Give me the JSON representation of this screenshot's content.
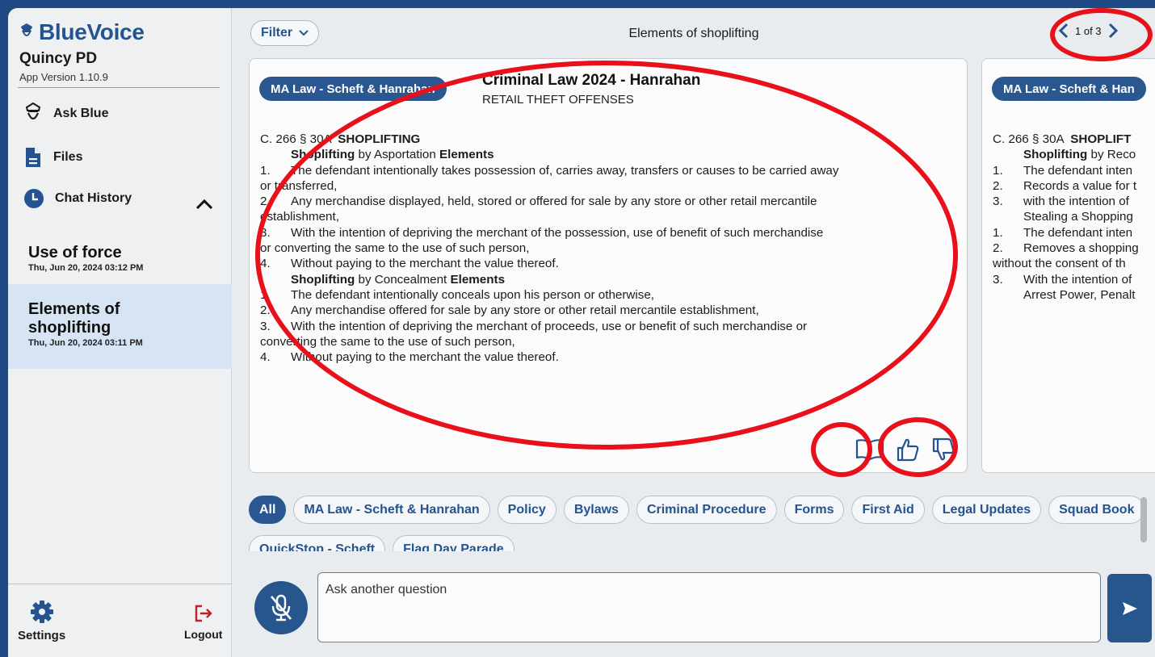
{
  "brand": {
    "name": "BlueVoice",
    "org": "Quincy PD",
    "version": "App Version 1.10.9"
  },
  "sidebar": {
    "nav": [
      {
        "label": "Ask Blue",
        "icon": "police-icon"
      },
      {
        "label": "Files",
        "icon": "file-icon"
      },
      {
        "label": "Chat History",
        "icon": "clock-icon"
      }
    ],
    "history": [
      {
        "title": "Use of force",
        "date": "Thu, Jun 20, 2024 03:12 PM",
        "active": false
      },
      {
        "title": "Elements of shoplifting",
        "date": "Thu, Jun 20, 2024 03:11 PM",
        "active": true
      }
    ],
    "settings_label": "Settings",
    "logout_label": "Logout"
  },
  "topbar": {
    "filter_label": "Filter",
    "topic": "Elements of shoplifting",
    "pager": "1 of 3"
  },
  "cards": [
    {
      "source": "MA Law - Scheft & Hanrahan",
      "title": "Criminal Law 2024 - Hanrahan",
      "subtitle": "RETAIL THEFT OFFENSES",
      "lines": [
        {
          "pre": "C. 266 § 30A  ",
          "bold": "SHOPLIFTING",
          "indent": false
        },
        {
          "bold": "Shoplifting",
          "mid": " by Asportation ",
          "bold2": "Elements",
          "indent": true
        },
        {
          "n": "1.",
          "text": "The defendant intentionally takes possession of, carries away, transfers or causes to be carried away"
        },
        {
          "plain": "or transferred,"
        },
        {
          "n": "2.",
          "text": "Any merchandise displayed, held, stored or offered for sale by any store or other retail mercantile"
        },
        {
          "plain": "establishment,"
        },
        {
          "n": "3.",
          "text": "With the intention of depriving the merchant of the possession, use of benefit of such merchandise"
        },
        {
          "plain": "or converting the same to the use of such person,"
        },
        {
          "n": "4.",
          "text": "Without paying to the merchant the value thereof."
        },
        {
          "bold": "Shoplifting",
          "mid": " by Concealment ",
          "bold2": "Elements",
          "indent": true
        },
        {
          "n": "1.",
          "text": "The defendant intentionally conceals upon his person or otherwise,"
        },
        {
          "n": "2.",
          "text": "Any merchandise offered for sale by any store or other retail mercantile establishment,"
        },
        {
          "n": "3.",
          "text": "With the intention of depriving the merchant of proceeds, use or benefit of such merchandise or"
        },
        {
          "plain": "converting the same to the use of such person,"
        },
        {
          "n": "4.",
          "text": "Without paying to the merchant the value thereof."
        }
      ]
    },
    {
      "source": "MA Law - Scheft & Han",
      "lines": [
        {
          "pre": "C. 266 § 30A  ",
          "bold": "SHOPLIFT",
          "indent": false
        },
        {
          "bold": "Shoplifting",
          "mid": " by Reco",
          "bold2": "",
          "indent": true
        },
        {
          "n": "1.",
          "text": "The defendant inten"
        },
        {
          "n": "2.",
          "text": "Records a value for t"
        },
        {
          "n": "3.",
          "text": "with the intention of"
        },
        {
          "ind": "Stealing a Shopping"
        },
        {
          "n": "1.",
          "text": "The defendant inten"
        },
        {
          "n": "2.",
          "text": "Removes a shopping"
        },
        {
          "plain": "without the consent of th"
        },
        {
          "n": "3.",
          "text": "With the intention of"
        },
        {
          "ind": "Arrest Power, Penalt"
        }
      ]
    }
  ],
  "categories": [
    "All",
    "MA Law - Scheft & Hanrahan",
    "Policy",
    "Bylaws",
    "Criminal Procedure",
    "Forms",
    "First Aid",
    "Legal Updates",
    "Squad Book",
    "QuickStop - Scheft",
    "Flag Day Parade"
  ],
  "input": {
    "placeholder": "Ask another question"
  },
  "colors": {
    "brand": "#24548f",
    "frame": "#1f4a86",
    "annotation": "#e8101a"
  }
}
